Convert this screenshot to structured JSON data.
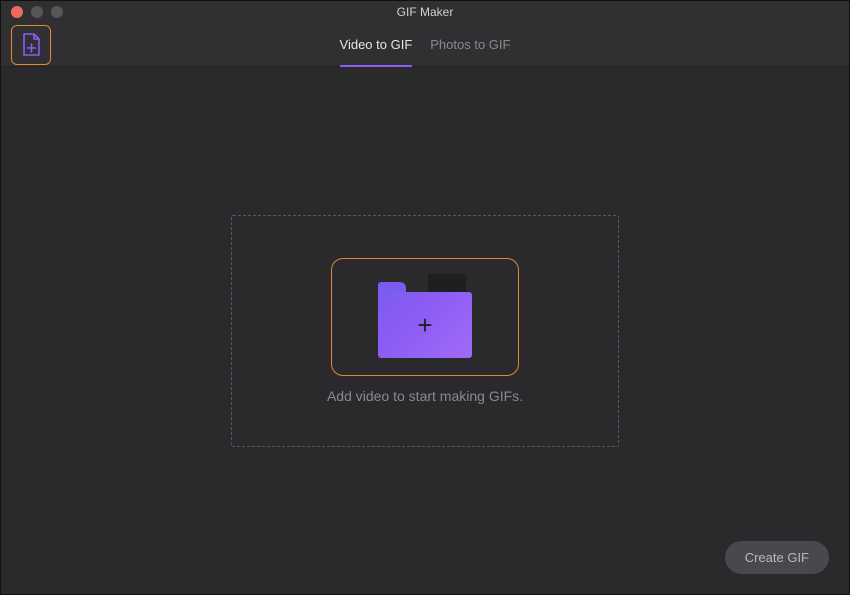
{
  "window": {
    "title": "GIF Maker"
  },
  "tabs": {
    "video": "Video to GIF",
    "photos": "Photos to GIF",
    "active": "video"
  },
  "dropzone": {
    "hint": "Add video to start making GIFs."
  },
  "buttons": {
    "create": "Create GIF"
  },
  "colors": {
    "accent_purple": "#8b5cf6",
    "accent_orange": "#e08a2c",
    "bg": "#2a2a2d",
    "bg_raised": "#303033"
  }
}
